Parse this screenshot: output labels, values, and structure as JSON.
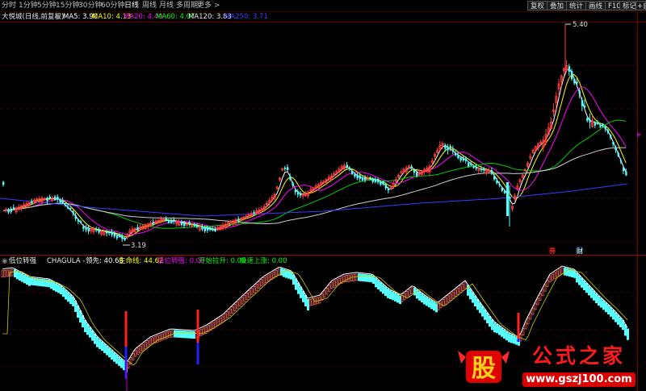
{
  "toolbar": {
    "periods": [
      "分时",
      "1分钟",
      "5分钟",
      "15分钟",
      "30分钟",
      "60分钟",
      "日线",
      "周线",
      "月线",
      "多周期",
      "更多 >"
    ],
    "active_period": "日线",
    "right_buttons": [
      "复权",
      "叠加",
      "统计",
      "画线",
      "F10",
      "标记",
      "+自选"
    ]
  },
  "main_chart": {
    "title": "大悦城(日线,前复权)",
    "ma": [
      {
        "label": "MA5: 3.90",
        "color": "#ffffff"
      },
      {
        "label": "MA10: 4.13",
        "color": "#ffff00"
      },
      {
        "label": "MA20: 4.40",
        "color": "#ff00ff"
      },
      {
        "label": "MA60: 4.07",
        "color": "#00ff00"
      },
      {
        "label": "MA120: 3.83",
        "color": "#e8e8e8"
      },
      {
        "label": "MA250: 3.71",
        "color": "#4040ff"
      }
    ],
    "high_label": "5.40",
    "low_label": "3.19",
    "markers": [
      "券",
      "财"
    ]
  },
  "indicator": {
    "name": "低位转强",
    "formula": "CHAGULA -",
    "values": [
      {
        "label": "领先: 40.68",
        "color": "#ffffff"
      },
      {
        "label": "生命线: 44.62",
        "color": "#ffff00"
      },
      {
        "label": "低位转强: 0.00",
        "color": "#ff00ff"
      },
      {
        "label": "开始拉升: 0.00",
        "color": "#00ff00"
      },
      {
        "label": "极速上涨: 0.00",
        "color": "#00ff00"
      }
    ]
  },
  "colors": {
    "up": "#ff3c3c",
    "down": "#54ffff",
    "grid": "#7a0000",
    "bg": "#000000"
  },
  "watermark": {
    "mark": "股",
    "name": "公式之家",
    "site": "www.gszj100.com"
  }
}
